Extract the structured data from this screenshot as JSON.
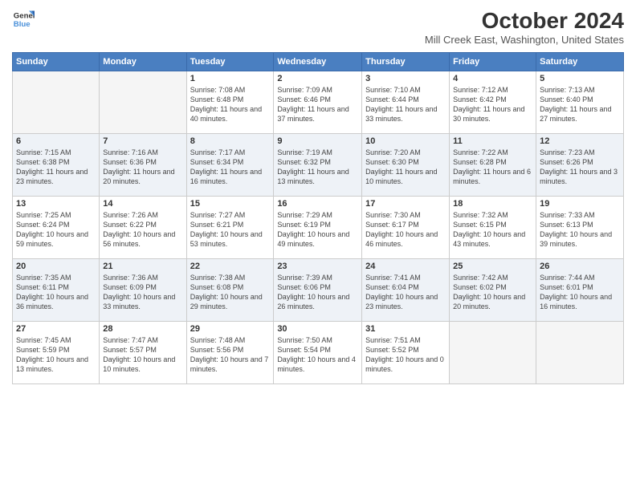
{
  "logo": {
    "line1": "General",
    "line2": "Blue"
  },
  "title": "October 2024",
  "subtitle": "Mill Creek East, Washington, United States",
  "days_of_week": [
    "Sunday",
    "Monday",
    "Tuesday",
    "Wednesday",
    "Thursday",
    "Friday",
    "Saturday"
  ],
  "weeks": [
    [
      {
        "day": "",
        "info": ""
      },
      {
        "day": "",
        "info": ""
      },
      {
        "day": "1",
        "info": "Sunrise: 7:08 AM\nSunset: 6:48 PM\nDaylight: 11 hours and 40 minutes."
      },
      {
        "day": "2",
        "info": "Sunrise: 7:09 AM\nSunset: 6:46 PM\nDaylight: 11 hours and 37 minutes."
      },
      {
        "day": "3",
        "info": "Sunrise: 7:10 AM\nSunset: 6:44 PM\nDaylight: 11 hours and 33 minutes."
      },
      {
        "day": "4",
        "info": "Sunrise: 7:12 AM\nSunset: 6:42 PM\nDaylight: 11 hours and 30 minutes."
      },
      {
        "day": "5",
        "info": "Sunrise: 7:13 AM\nSunset: 6:40 PM\nDaylight: 11 hours and 27 minutes."
      }
    ],
    [
      {
        "day": "6",
        "info": "Sunrise: 7:15 AM\nSunset: 6:38 PM\nDaylight: 11 hours and 23 minutes."
      },
      {
        "day": "7",
        "info": "Sunrise: 7:16 AM\nSunset: 6:36 PM\nDaylight: 11 hours and 20 minutes."
      },
      {
        "day": "8",
        "info": "Sunrise: 7:17 AM\nSunset: 6:34 PM\nDaylight: 11 hours and 16 minutes."
      },
      {
        "day": "9",
        "info": "Sunrise: 7:19 AM\nSunset: 6:32 PM\nDaylight: 11 hours and 13 minutes."
      },
      {
        "day": "10",
        "info": "Sunrise: 7:20 AM\nSunset: 6:30 PM\nDaylight: 11 hours and 10 minutes."
      },
      {
        "day": "11",
        "info": "Sunrise: 7:22 AM\nSunset: 6:28 PM\nDaylight: 11 hours and 6 minutes."
      },
      {
        "day": "12",
        "info": "Sunrise: 7:23 AM\nSunset: 6:26 PM\nDaylight: 11 hours and 3 minutes."
      }
    ],
    [
      {
        "day": "13",
        "info": "Sunrise: 7:25 AM\nSunset: 6:24 PM\nDaylight: 10 hours and 59 minutes."
      },
      {
        "day": "14",
        "info": "Sunrise: 7:26 AM\nSunset: 6:22 PM\nDaylight: 10 hours and 56 minutes."
      },
      {
        "day": "15",
        "info": "Sunrise: 7:27 AM\nSunset: 6:21 PM\nDaylight: 10 hours and 53 minutes."
      },
      {
        "day": "16",
        "info": "Sunrise: 7:29 AM\nSunset: 6:19 PM\nDaylight: 10 hours and 49 minutes."
      },
      {
        "day": "17",
        "info": "Sunrise: 7:30 AM\nSunset: 6:17 PM\nDaylight: 10 hours and 46 minutes."
      },
      {
        "day": "18",
        "info": "Sunrise: 7:32 AM\nSunset: 6:15 PM\nDaylight: 10 hours and 43 minutes."
      },
      {
        "day": "19",
        "info": "Sunrise: 7:33 AM\nSunset: 6:13 PM\nDaylight: 10 hours and 39 minutes."
      }
    ],
    [
      {
        "day": "20",
        "info": "Sunrise: 7:35 AM\nSunset: 6:11 PM\nDaylight: 10 hours and 36 minutes."
      },
      {
        "day": "21",
        "info": "Sunrise: 7:36 AM\nSunset: 6:09 PM\nDaylight: 10 hours and 33 minutes."
      },
      {
        "day": "22",
        "info": "Sunrise: 7:38 AM\nSunset: 6:08 PM\nDaylight: 10 hours and 29 minutes."
      },
      {
        "day": "23",
        "info": "Sunrise: 7:39 AM\nSunset: 6:06 PM\nDaylight: 10 hours and 26 minutes."
      },
      {
        "day": "24",
        "info": "Sunrise: 7:41 AM\nSunset: 6:04 PM\nDaylight: 10 hours and 23 minutes."
      },
      {
        "day": "25",
        "info": "Sunrise: 7:42 AM\nSunset: 6:02 PM\nDaylight: 10 hours and 20 minutes."
      },
      {
        "day": "26",
        "info": "Sunrise: 7:44 AM\nSunset: 6:01 PM\nDaylight: 10 hours and 16 minutes."
      }
    ],
    [
      {
        "day": "27",
        "info": "Sunrise: 7:45 AM\nSunset: 5:59 PM\nDaylight: 10 hours and 13 minutes."
      },
      {
        "day": "28",
        "info": "Sunrise: 7:47 AM\nSunset: 5:57 PM\nDaylight: 10 hours and 10 minutes."
      },
      {
        "day": "29",
        "info": "Sunrise: 7:48 AM\nSunset: 5:56 PM\nDaylight: 10 hours and 7 minutes."
      },
      {
        "day": "30",
        "info": "Sunrise: 7:50 AM\nSunset: 5:54 PM\nDaylight: 10 hours and 4 minutes."
      },
      {
        "day": "31",
        "info": "Sunrise: 7:51 AM\nSunset: 5:52 PM\nDaylight: 10 hours and 0 minutes."
      },
      {
        "day": "",
        "info": ""
      },
      {
        "day": "",
        "info": ""
      }
    ]
  ],
  "shaded_rows": [
    1,
    3
  ]
}
